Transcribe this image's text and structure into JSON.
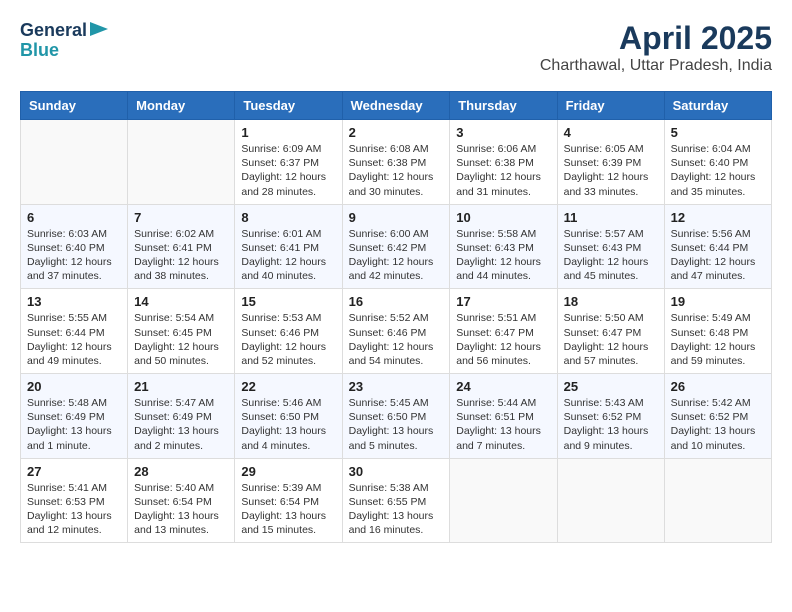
{
  "header": {
    "logo_line1": "General",
    "logo_line2": "Blue",
    "title": "April 2025",
    "subtitle": "Charthawal, Uttar Pradesh, India"
  },
  "days_of_week": [
    "Sunday",
    "Monday",
    "Tuesday",
    "Wednesday",
    "Thursday",
    "Friday",
    "Saturday"
  ],
  "weeks": [
    [
      {
        "day": "",
        "lines": []
      },
      {
        "day": "",
        "lines": []
      },
      {
        "day": "1",
        "lines": [
          "Sunrise: 6:09 AM",
          "Sunset: 6:37 PM",
          "Daylight: 12 hours and 28 minutes."
        ]
      },
      {
        "day": "2",
        "lines": [
          "Sunrise: 6:08 AM",
          "Sunset: 6:38 PM",
          "Daylight: 12 hours and 30 minutes."
        ]
      },
      {
        "day": "3",
        "lines": [
          "Sunrise: 6:06 AM",
          "Sunset: 6:38 PM",
          "Daylight: 12 hours and 31 minutes."
        ]
      },
      {
        "day": "4",
        "lines": [
          "Sunrise: 6:05 AM",
          "Sunset: 6:39 PM",
          "Daylight: 12 hours and 33 minutes."
        ]
      },
      {
        "day": "5",
        "lines": [
          "Sunrise: 6:04 AM",
          "Sunset: 6:40 PM",
          "Daylight: 12 hours and 35 minutes."
        ]
      }
    ],
    [
      {
        "day": "6",
        "lines": [
          "Sunrise: 6:03 AM",
          "Sunset: 6:40 PM",
          "Daylight: 12 hours and 37 minutes."
        ]
      },
      {
        "day": "7",
        "lines": [
          "Sunrise: 6:02 AM",
          "Sunset: 6:41 PM",
          "Daylight: 12 hours and 38 minutes."
        ]
      },
      {
        "day": "8",
        "lines": [
          "Sunrise: 6:01 AM",
          "Sunset: 6:41 PM",
          "Daylight: 12 hours and 40 minutes."
        ]
      },
      {
        "day": "9",
        "lines": [
          "Sunrise: 6:00 AM",
          "Sunset: 6:42 PM",
          "Daylight: 12 hours and 42 minutes."
        ]
      },
      {
        "day": "10",
        "lines": [
          "Sunrise: 5:58 AM",
          "Sunset: 6:43 PM",
          "Daylight: 12 hours and 44 minutes."
        ]
      },
      {
        "day": "11",
        "lines": [
          "Sunrise: 5:57 AM",
          "Sunset: 6:43 PM",
          "Daylight: 12 hours and 45 minutes."
        ]
      },
      {
        "day": "12",
        "lines": [
          "Sunrise: 5:56 AM",
          "Sunset: 6:44 PM",
          "Daylight: 12 hours and 47 minutes."
        ]
      }
    ],
    [
      {
        "day": "13",
        "lines": [
          "Sunrise: 5:55 AM",
          "Sunset: 6:44 PM",
          "Daylight: 12 hours and 49 minutes."
        ]
      },
      {
        "day": "14",
        "lines": [
          "Sunrise: 5:54 AM",
          "Sunset: 6:45 PM",
          "Daylight: 12 hours and 50 minutes."
        ]
      },
      {
        "day": "15",
        "lines": [
          "Sunrise: 5:53 AM",
          "Sunset: 6:46 PM",
          "Daylight: 12 hours and 52 minutes."
        ]
      },
      {
        "day": "16",
        "lines": [
          "Sunrise: 5:52 AM",
          "Sunset: 6:46 PM",
          "Daylight: 12 hours and 54 minutes."
        ]
      },
      {
        "day": "17",
        "lines": [
          "Sunrise: 5:51 AM",
          "Sunset: 6:47 PM",
          "Daylight: 12 hours and 56 minutes."
        ]
      },
      {
        "day": "18",
        "lines": [
          "Sunrise: 5:50 AM",
          "Sunset: 6:47 PM",
          "Daylight: 12 hours and 57 minutes."
        ]
      },
      {
        "day": "19",
        "lines": [
          "Sunrise: 5:49 AM",
          "Sunset: 6:48 PM",
          "Daylight: 12 hours and 59 minutes."
        ]
      }
    ],
    [
      {
        "day": "20",
        "lines": [
          "Sunrise: 5:48 AM",
          "Sunset: 6:49 PM",
          "Daylight: 13 hours and 1 minute."
        ]
      },
      {
        "day": "21",
        "lines": [
          "Sunrise: 5:47 AM",
          "Sunset: 6:49 PM",
          "Daylight: 13 hours and 2 minutes."
        ]
      },
      {
        "day": "22",
        "lines": [
          "Sunrise: 5:46 AM",
          "Sunset: 6:50 PM",
          "Daylight: 13 hours and 4 minutes."
        ]
      },
      {
        "day": "23",
        "lines": [
          "Sunrise: 5:45 AM",
          "Sunset: 6:50 PM",
          "Daylight: 13 hours and 5 minutes."
        ]
      },
      {
        "day": "24",
        "lines": [
          "Sunrise: 5:44 AM",
          "Sunset: 6:51 PM",
          "Daylight: 13 hours and 7 minutes."
        ]
      },
      {
        "day": "25",
        "lines": [
          "Sunrise: 5:43 AM",
          "Sunset: 6:52 PM",
          "Daylight: 13 hours and 9 minutes."
        ]
      },
      {
        "day": "26",
        "lines": [
          "Sunrise: 5:42 AM",
          "Sunset: 6:52 PM",
          "Daylight: 13 hours and 10 minutes."
        ]
      }
    ],
    [
      {
        "day": "27",
        "lines": [
          "Sunrise: 5:41 AM",
          "Sunset: 6:53 PM",
          "Daylight: 13 hours and 12 minutes."
        ]
      },
      {
        "day": "28",
        "lines": [
          "Sunrise: 5:40 AM",
          "Sunset: 6:54 PM",
          "Daylight: 13 hours and 13 minutes."
        ]
      },
      {
        "day": "29",
        "lines": [
          "Sunrise: 5:39 AM",
          "Sunset: 6:54 PM",
          "Daylight: 13 hours and 15 minutes."
        ]
      },
      {
        "day": "30",
        "lines": [
          "Sunrise: 5:38 AM",
          "Sunset: 6:55 PM",
          "Daylight: 13 hours and 16 minutes."
        ]
      },
      {
        "day": "",
        "lines": []
      },
      {
        "day": "",
        "lines": []
      },
      {
        "day": "",
        "lines": []
      }
    ]
  ]
}
